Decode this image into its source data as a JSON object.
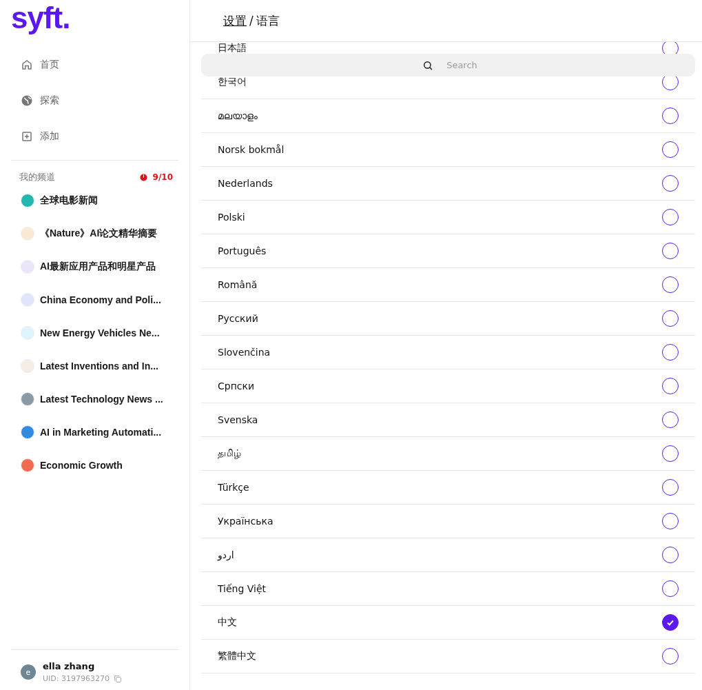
{
  "logo": "syft.",
  "nav": [
    {
      "kind": "home",
      "label": "首页"
    },
    {
      "kind": "globe",
      "label": "探索"
    },
    {
      "kind": "add",
      "label": "添加"
    }
  ],
  "channels_section": {
    "title": "我的频道",
    "count": "9/10"
  },
  "channels": [
    {
      "name": "全球电影新闻",
      "color": "#22b8b0"
    },
    {
      "name": "《Nature》AI论文精华摘要",
      "color": "#fbe9d6"
    },
    {
      "name": "AI最新应用产品和明星产品",
      "color": "#ece4fb"
    },
    {
      "name": "China Economy and Poli...",
      "color": "#e2e4fb"
    },
    {
      "name": "New Energy Vehicles Ne...",
      "color": "#dff5fb"
    },
    {
      "name": "Latest Inventions and In...",
      "color": "#f6eee4"
    },
    {
      "name": "Latest Technology News ...",
      "color": "#8a9aa6"
    },
    {
      "name": "AI in Marketing Automati...",
      "color": "#2f8ce0"
    },
    {
      "name": "Economic Growth",
      "color": "#f06b4f"
    }
  ],
  "user": {
    "avatar": "e",
    "name": "ella zhang",
    "uid": "UID: 3197963270"
  },
  "breadcrumb": {
    "parent": "设置",
    "separator": "/",
    "current": "语言"
  },
  "search": {
    "placeholder": "Search"
  },
  "languages": [
    {
      "label": "日本語",
      "selected": false
    },
    {
      "label": "한국어",
      "selected": false
    },
    {
      "label": "മലയാളം",
      "selected": false
    },
    {
      "label": "Norsk bokmål",
      "selected": false
    },
    {
      "label": "Nederlands",
      "selected": false
    },
    {
      "label": "Polski",
      "selected": false
    },
    {
      "label": "Português",
      "selected": false
    },
    {
      "label": "Română",
      "selected": false
    },
    {
      "label": "Русский",
      "selected": false
    },
    {
      "label": "Slovenčina",
      "selected": false
    },
    {
      "label": "Српски",
      "selected": false
    },
    {
      "label": "Svenska",
      "selected": false
    },
    {
      "label": "தமிழ்",
      "selected": false
    },
    {
      "label": "Türkçe",
      "selected": false
    },
    {
      "label": "Українська",
      "selected": false
    },
    {
      "label": "اردو",
      "selected": false
    },
    {
      "label": "Tiếng Việt",
      "selected": false
    },
    {
      "label": "中文",
      "selected": true
    },
    {
      "label": "繁體中文",
      "selected": false
    }
  ]
}
